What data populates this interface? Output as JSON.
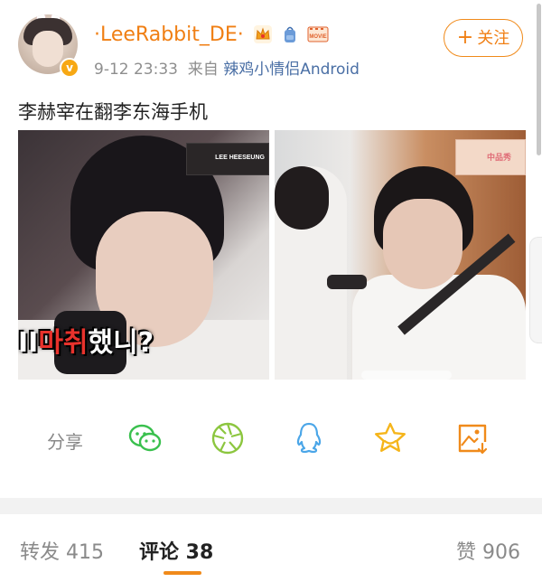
{
  "post": {
    "username": "·LeeRabbit_DE·",
    "badges": [
      "crown-icon",
      "backpack-icon",
      "movie-icon"
    ],
    "badge_movie_label": "MOVIE",
    "timestamp": "9-12 23:33",
    "source_prefix": "来自",
    "source": "辣鸡小情侣Android",
    "follow_label": "关注",
    "text": "李赫宰在翻李东海手机",
    "images": [
      {
        "overlay_label": "LEE HEESEUNG",
        "subtitle_prefix": "II",
        "subtitle_red": "마취",
        "subtitle_rest": "했니?"
      },
      {
        "overlay_label": "中品秀"
      }
    ]
  },
  "share": {
    "label": "分享",
    "targets": [
      "wechat-icon",
      "moments-icon",
      "qq-icon",
      "favorite-icon",
      "save-image-icon"
    ]
  },
  "tabs": {
    "reposts": "转发 415",
    "comments": "评论 38",
    "likes": "赞 906",
    "active": "comments"
  },
  "colors": {
    "accent": "#f07f14",
    "wechat": "#3ac04e",
    "moments": "#8cc63f",
    "qq": "#4ba6e8",
    "favorite": "#f5b51b",
    "save": "#f08a1a"
  }
}
